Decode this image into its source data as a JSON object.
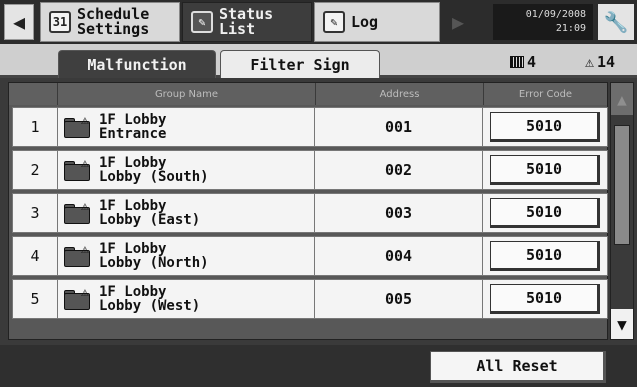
{
  "nav": {
    "back_icon": "◀",
    "forward_icon": "▶",
    "schedule": {
      "label": "Schedule\nSettings",
      "icon": "31"
    },
    "status": {
      "label": "Status\n    List",
      "icon": "✎"
    },
    "log": {
      "label": "Log",
      "icon": "✎"
    },
    "datetime": "01/09/2008\n21:09",
    "wrench_icon": "🔧"
  },
  "tabs": [
    {
      "label": "Malfunction",
      "active": true
    },
    {
      "label": "Filter Sign",
      "active": false
    }
  ],
  "counts": {
    "units": "4",
    "warnings": "14",
    "warning_icon": "⚠"
  },
  "table": {
    "headers": [
      "Group Name",
      "Address",
      "Error Code"
    ],
    "rows": [
      {
        "num": "1",
        "name1": "1F Lobby",
        "name2": "Entrance",
        "address": "001",
        "error": "5010"
      },
      {
        "num": "2",
        "name1": "1F Lobby",
        "name2": "Lobby (South)",
        "address": "002",
        "error": "5010"
      },
      {
        "num": "3",
        "name1": "1F Lobby",
        "name2": "Lobby (East)",
        "address": "003",
        "error": "5010"
      },
      {
        "num": "4",
        "name1": "1F Lobby",
        "name2": "Lobby (North)",
        "address": "004",
        "error": "5010"
      },
      {
        "num": "5",
        "name1": "1F Lobby",
        "name2": "Lobby (West)",
        "address": "005",
        "error": "5010"
      }
    ]
  },
  "scroll": {
    "up_icon": "▲",
    "down_icon": "▼"
  },
  "footer": {
    "all_reset": "All Reset"
  },
  "colors": {
    "background": "#3a3a3a",
    "active_tab": "#3f3f3f",
    "row_bg": "#f4f4f4"
  }
}
